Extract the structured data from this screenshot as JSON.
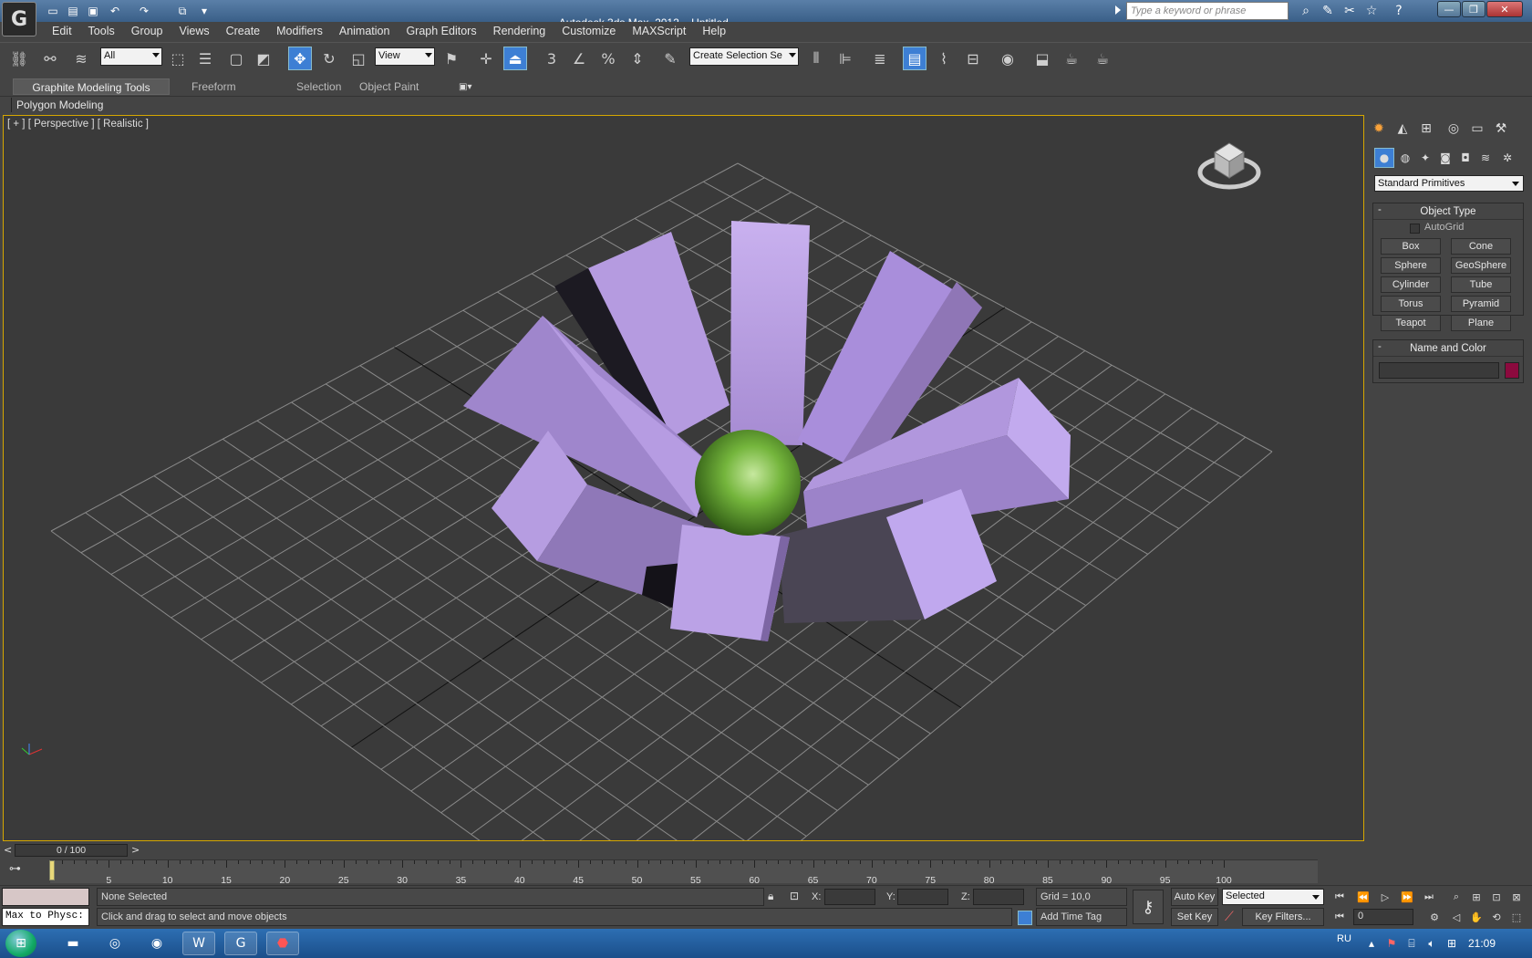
{
  "title": {
    "app": "Autodesk 3ds Max  2012",
    "doc": "Untitled"
  },
  "search": {
    "placeholder": "Type a keyword or phrase"
  },
  "menu": [
    "Edit",
    "Tools",
    "Group",
    "Views",
    "Create",
    "Modifiers",
    "Animation",
    "Graph Editors",
    "Rendering",
    "Customize",
    "MAXScript",
    "Help"
  ],
  "toolbar": {
    "selection_filter": "All",
    "ref_coord": "View",
    "named_selection": "Create Selection Se"
  },
  "ribbon": {
    "tabs": [
      "Graphite Modeling Tools",
      "Freeform",
      "Selection",
      "Object Paint"
    ],
    "active_tab": 0,
    "panel_label": "Polygon Modeling"
  },
  "viewport": {
    "label": "[ + ] [ Perspective ] [ Realistic ]",
    "colors": {
      "petal": "#b89ee0",
      "petal_dark": "#8f76b6",
      "sphere": "#72b23a",
      "grid": "#8a8a8a",
      "border": "#d6a700"
    }
  },
  "command_panel": {
    "dropdown": "Standard Primitives",
    "object_type": {
      "title": "Object Type",
      "autogrid": "AutoGrid",
      "buttons": [
        "Box",
        "Cone",
        "Sphere",
        "GeoSphere",
        "Cylinder",
        "Tube",
        "Torus",
        "Pyramid",
        "Teapot",
        "Plane"
      ]
    },
    "name_color": {
      "title": "Name and Color",
      "swatch_color": "#8c0a3e"
    }
  },
  "timeline": {
    "slider": "0 / 100",
    "ticks": [
      "5",
      "10",
      "15",
      "20",
      "25",
      "30",
      "35",
      "40",
      "45",
      "50",
      "55",
      "60",
      "65",
      "70",
      "75",
      "80",
      "85",
      "90",
      "95",
      "100"
    ]
  },
  "status": {
    "maxscript": "Max to Physc:",
    "selection": "None Selected",
    "prompt": "Click and drag to select and move objects",
    "x_label": "X:",
    "y_label": "Y:",
    "z_label": "Z:",
    "grid": "Grid = 10,0",
    "add_time_tag": "Add Time Tag",
    "auto_key": "Auto Key",
    "set_key": "Set Key",
    "key_mode": "Selected",
    "key_filters": "Key Filters...",
    "frame": "0"
  },
  "taskbar": {
    "lang": "RU",
    "clock": "21:09"
  }
}
